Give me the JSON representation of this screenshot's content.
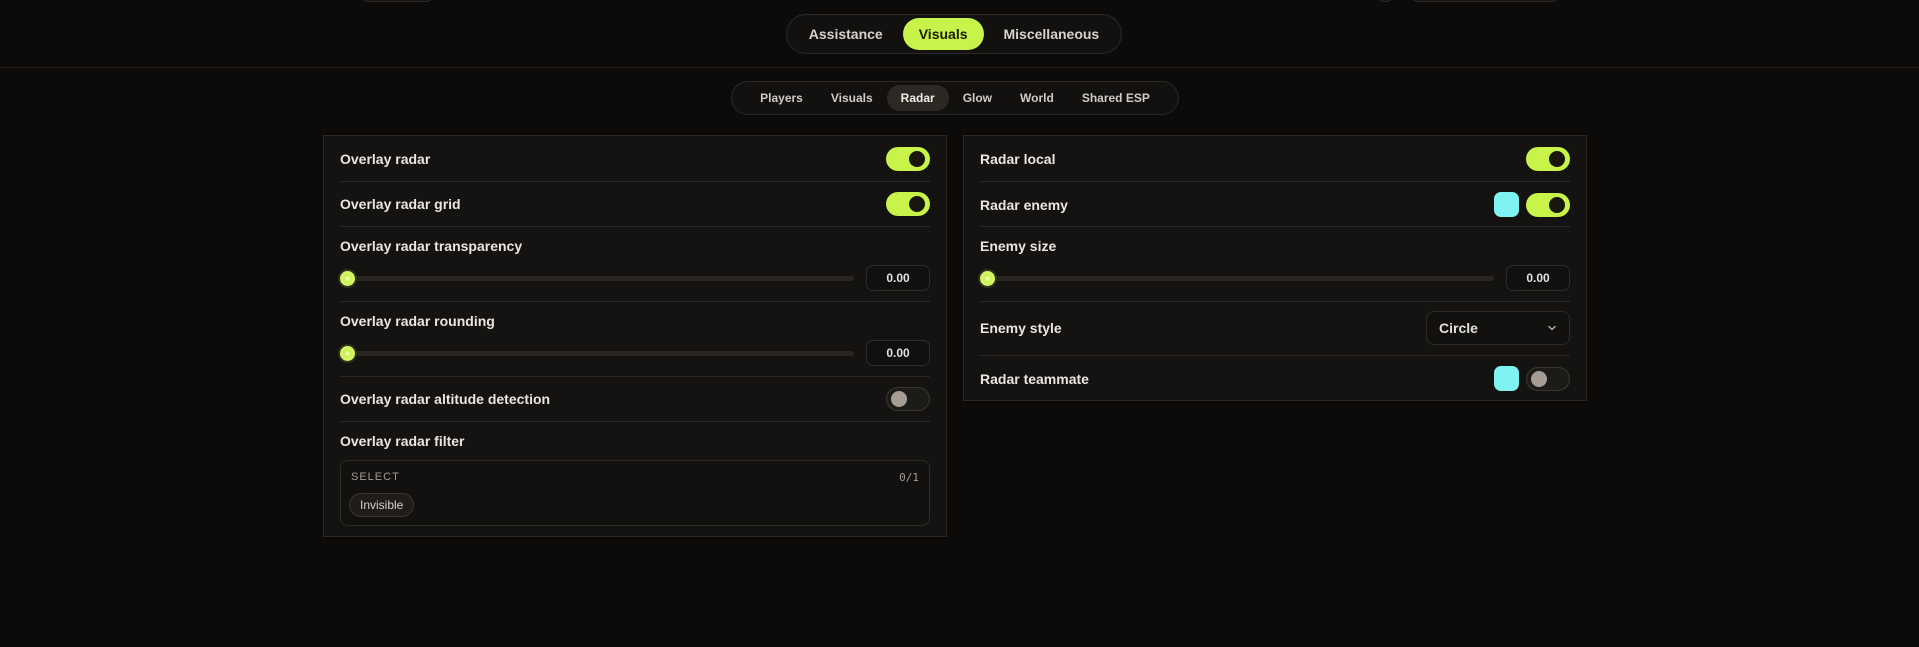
{
  "main_tabs": [
    {
      "label": "Assistance",
      "active": false
    },
    {
      "label": "Visuals",
      "active": true
    },
    {
      "label": "Miscellaneous",
      "active": false
    }
  ],
  "sub_tabs": [
    {
      "label": "Players",
      "active": false
    },
    {
      "label": "Visuals",
      "active": false
    },
    {
      "label": "Radar",
      "active": true
    },
    {
      "label": "Glow",
      "active": false
    },
    {
      "label": "World",
      "active": false
    },
    {
      "label": "Shared ESP",
      "active": false
    }
  ],
  "left_panel": {
    "overlay_radar": {
      "label": "Overlay radar",
      "enabled": true
    },
    "overlay_radar_grid": {
      "label": "Overlay radar grid",
      "enabled": true
    },
    "overlay_radar_transparency": {
      "label": "Overlay radar transparency",
      "value": "0.00"
    },
    "overlay_radar_rounding": {
      "label": "Overlay radar rounding",
      "value": "0.00"
    },
    "overlay_radar_altitude_detection": {
      "label": "Overlay radar altitude detection",
      "enabled": false
    },
    "overlay_radar_filter": {
      "label": "Overlay radar filter",
      "select_label": "SELECT",
      "count": "0/1",
      "options": [
        "Invisible"
      ]
    }
  },
  "right_panel": {
    "radar_local": {
      "label": "Radar local",
      "enabled": true
    },
    "radar_enemy": {
      "label": "Radar enemy",
      "enabled": true,
      "color": "#7ff2f2"
    },
    "enemy_size": {
      "label": "Enemy size",
      "value": "0.00"
    },
    "enemy_style": {
      "label": "Enemy style",
      "value": "Circle"
    },
    "radar_teammate": {
      "label": "Radar teammate",
      "enabled": false,
      "color": "#7ff2f2"
    }
  },
  "colors": {
    "accent": "#c8f34a",
    "background": "#0c0b0a",
    "panel": "#151311",
    "swatch": "#7ff2f2"
  }
}
